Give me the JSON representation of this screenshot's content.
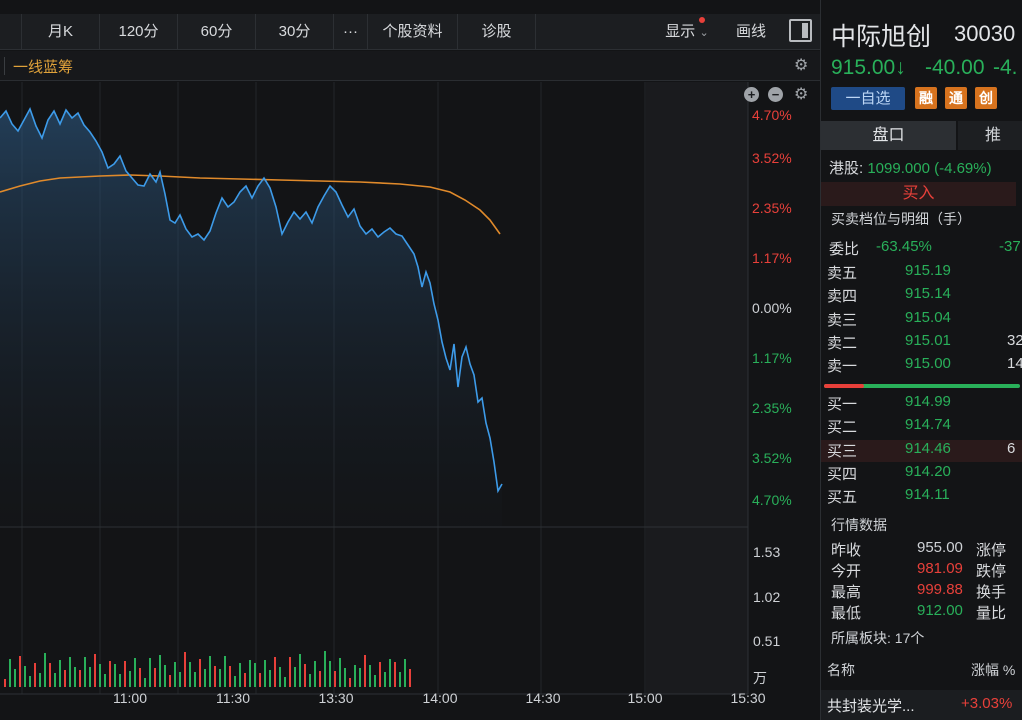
{
  "toolbar": {
    "items": [
      "月K",
      "120分",
      "60分",
      "30分",
      "···",
      "个股资料",
      "诊股"
    ],
    "display_label": "显示",
    "draw_label": "画线"
  },
  "subbar": {
    "indicator": "一线蓝筹"
  },
  "axis": {
    "pct_labels": [
      "4.70%",
      "3.52%",
      "2.35%",
      "1.17%",
      "0.00%",
      "1.17%",
      "2.35%",
      "3.52%",
      "4.70%"
    ],
    "vol_labels": [
      "1.53",
      "1.02",
      "0.51",
      "万"
    ],
    "time_labels": [
      "11:00",
      "11:30",
      "13:30",
      "14:00",
      "14:30",
      "15:00",
      "15:30"
    ]
  },
  "quote": {
    "name": "中际旭创",
    "code": "30030",
    "price": "915.00↓",
    "change": "-40.00",
    "change_pct": "-4.",
    "watch_button": "一自选",
    "tags": [
      "融",
      "通",
      "创"
    ]
  },
  "tabs": {
    "active": "盘口",
    "next": "推"
  },
  "hk_line": {
    "label": "港股:",
    "value": "1099.000 (-4.69%)"
  },
  "buy_label": "买入",
  "depth_title": "买卖档位与明细（手）",
  "weibi": {
    "label": "委比",
    "value": "-63.45%",
    "extra": "-37"
  },
  "asks": [
    {
      "label": "卖五",
      "price": "915.19",
      "vol": ""
    },
    {
      "label": "卖四",
      "price": "915.14",
      "vol": ""
    },
    {
      "label": "卖三",
      "price": "915.04",
      "vol": ""
    },
    {
      "label": "卖二",
      "price": "915.01",
      "vol": "32"
    },
    {
      "label": "卖一",
      "price": "915.00",
      "vol": "14"
    }
  ],
  "bids": [
    {
      "label": "买一",
      "price": "914.99",
      "vol": ""
    },
    {
      "label": "买二",
      "price": "914.74",
      "vol": ""
    },
    {
      "label": "买三",
      "price": "914.46",
      "vol": "6"
    },
    {
      "label": "买四",
      "price": "914.20",
      "vol": ""
    },
    {
      "label": "买五",
      "price": "914.11",
      "vol": ""
    }
  ],
  "market_title": "行情数据",
  "market": [
    {
      "label": "昨收",
      "value": "955.00",
      "right": "涨停"
    },
    {
      "label": "今开",
      "value": "981.09",
      "right": "跌停"
    },
    {
      "label": "最高",
      "value": "999.88",
      "right": "换手"
    },
    {
      "label": "最低",
      "value": "912.00",
      "right": "量比"
    }
  ],
  "sector": {
    "label": "所属板块:",
    "count": "17个"
  },
  "sector_table": {
    "col_name": "名称",
    "col_change": "涨幅 %"
  },
  "sector_row": {
    "name": "共封装光学...",
    "change": "+3.03%"
  },
  "colors": {
    "up": "#e8403a",
    "down": "#29b05a",
    "price_line": "#3d9be9",
    "avg_line": "#e08a2b"
  },
  "chart_data": {
    "type": "line",
    "x": [
      "11:00",
      "11:30",
      "13:30",
      "14:00",
      "14:30",
      "15:00",
      "15:30"
    ],
    "series": [],
    "ylim_pct": [
      -4.7,
      4.7
    ],
    "volume_labels": [
      "1.53",
      "1.02",
      "0.51"
    ],
    "volume_unit": "万"
  }
}
